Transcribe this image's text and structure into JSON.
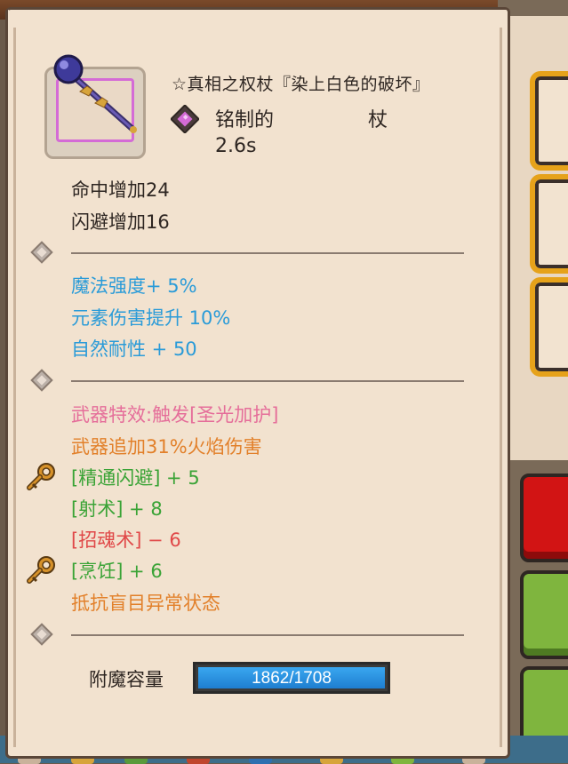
{
  "item": {
    "name": "☆真相之权杖『染上白色的破坏』",
    "icon": "staff-icon",
    "rarity_color": "#d46bd6",
    "craft_label": "铭制的",
    "type_label": "杖",
    "attack_speed": "2.6s"
  },
  "base_stats": [
    "命中增加24",
    "闪避增加16"
  ],
  "magic_stats": [
    "魔法强度+ 5%",
    "元素伤害提升 10%",
    "自然耐性 + 50"
  ],
  "special": {
    "effect": "武器特效:触发[圣光加护]",
    "fire_damage": "武器追加31%火焰伤害",
    "skills": [
      {
        "text": "[精通闪避] + 5",
        "color": "#3aa336",
        "key_icon": true
      },
      {
        "text": "[射术] + 8",
        "color": "#3aa336",
        "key_icon": false
      },
      {
        "text": "[招魂术] − 6",
        "color": "#e04848",
        "key_icon": false
      },
      {
        "text": "[烹饪] + 6",
        "color": "#3aa336",
        "key_icon": true
      }
    ],
    "resist": "抵抗盲目异常状态"
  },
  "enchant": {
    "label": "附魔容量",
    "value_text": "1862/1708",
    "fill_fraction": 1.0
  },
  "colors": {
    "blue": "#2a9bd8",
    "pink": "#e56e9a",
    "orange": "#e2802a",
    "green": "#3aa336",
    "red": "#e04848"
  }
}
